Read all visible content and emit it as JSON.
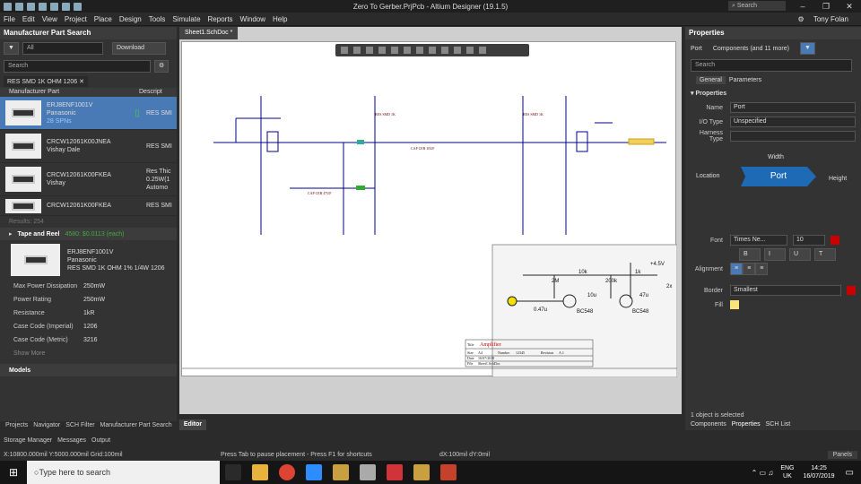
{
  "window": {
    "title": "Zero To Gerber.PrjPcb - Altium Designer (19.1.5)",
    "search_label": "Search"
  },
  "menu": [
    "File",
    "Edit",
    "View",
    "Project",
    "Place",
    "Design",
    "Tools",
    "Simulate",
    "Reports",
    "Window",
    "Help"
  ],
  "user": "Tony Folan",
  "left_panel": {
    "title": "Manufacturer Part Search",
    "filter": "All",
    "download": "Download",
    "search_placeholder": "Search",
    "query_tag": "RES SMD 1K OHM 1206",
    "col_part": "Manufacturer Part",
    "col_desc": "Descript",
    "parts": [
      {
        "name": "ERJ8ENF1001V",
        "mfr": "Panasonic",
        "extra": "28 SPNs",
        "desc": "RES SMI"
      },
      {
        "name": "CRCW12061K00JNEA",
        "mfr": "Vishay Dale",
        "extra": "",
        "desc": "RES SMI"
      },
      {
        "name": "CRCW12061K00FKEA",
        "mfr": "Vishay",
        "extra": "",
        "desc": "Res Thic 0.25W(1 Automo"
      },
      {
        "name": "CRCW12061K00FKEA",
        "mfr": "",
        "extra": "",
        "desc": "RES SMI"
      }
    ],
    "results": "Results: 254",
    "tape_reel": "Tape and Reel",
    "price": "4580: $0.0113 (each)",
    "detail": {
      "part": "ERJ8ENF1001V",
      "mfr": "Panasonic",
      "desc": "RES SMD 1K OHM 1% 1/4W 1206"
    },
    "specs": [
      {
        "k": "Max Power Dissipation",
        "v": "250mW"
      },
      {
        "k": "Power Rating",
        "v": "250mW"
      },
      {
        "k": "Resistance",
        "v": "1kR"
      },
      {
        "k": "Case Code (Imperial)",
        "v": "1206"
      },
      {
        "k": "Case Code (Metric)",
        "v": "3216"
      }
    ],
    "show_more": "Show More",
    "models": "Models"
  },
  "bottom_tabs": [
    "Projects",
    "Navigator",
    "SCH Filter",
    "Manufacturer Part Search"
  ],
  "editor_tab": "Editor",
  "doc_tab": "Sheet1.SchDoc *",
  "right_panel": {
    "title": "Properties",
    "subtitle_left": "Port",
    "subtitle_right": "Components (and 11 more)",
    "search_placeholder": "Search",
    "tabs": [
      "General",
      "Parameters"
    ],
    "section": "Properties",
    "name_label": "Name",
    "name_value": "Port",
    "io_label": "I/O Type",
    "io_value": "Unspecified",
    "harness_label": "Harness Type",
    "harness_value": "",
    "diagram": {
      "width": "Width",
      "location": "Location",
      "port": "Port",
      "height": "Height"
    },
    "font_label": "Font",
    "font_value": "Times Ne...",
    "font_size": "10",
    "alignment_label": "Alignment",
    "border_label": "Border",
    "border_value": "Smallest",
    "fill_label": "Fill",
    "selected": "1 object is selected",
    "bottom_tabs": [
      "Components",
      "Properties",
      "SCH List"
    ]
  },
  "storage_tabs": [
    "Storage Manager",
    "Messages",
    "Output"
  ],
  "status": {
    "coords": "X:10800.000mil Y:5000.000mil",
    "grid": "Grid:100mil",
    "hint": "Press Tab to pause placement - Press F1 for shortcuts",
    "delta": "dX:100mil dY:0mil",
    "panels": "Panels"
  },
  "taskbar": {
    "search": "Type here to search",
    "lang": "ENG",
    "region": "UK",
    "time": "14:25",
    "date": "16/07/2019"
  },
  "schematic": {
    "title_label": "Title",
    "title_value": "Amplifier",
    "size_label": "Size",
    "size_value": "A4",
    "number_label": "Number",
    "number_value": "12345",
    "revision_label": "Revision",
    "revision_value": "A.1",
    "date_label": "Date",
    "date_value": "16/07/2019",
    "file_label": "File",
    "file_value": "Sheet1.SchDoc",
    "vcc": "+4.5V",
    "r_labels": [
      "2M",
      "10k",
      "200k",
      "1k"
    ],
    "c_labels": [
      "0.47u",
      "10u",
      "47u"
    ],
    "q_labels": [
      "BC548",
      "BC548"
    ],
    "port_value": "2x"
  }
}
